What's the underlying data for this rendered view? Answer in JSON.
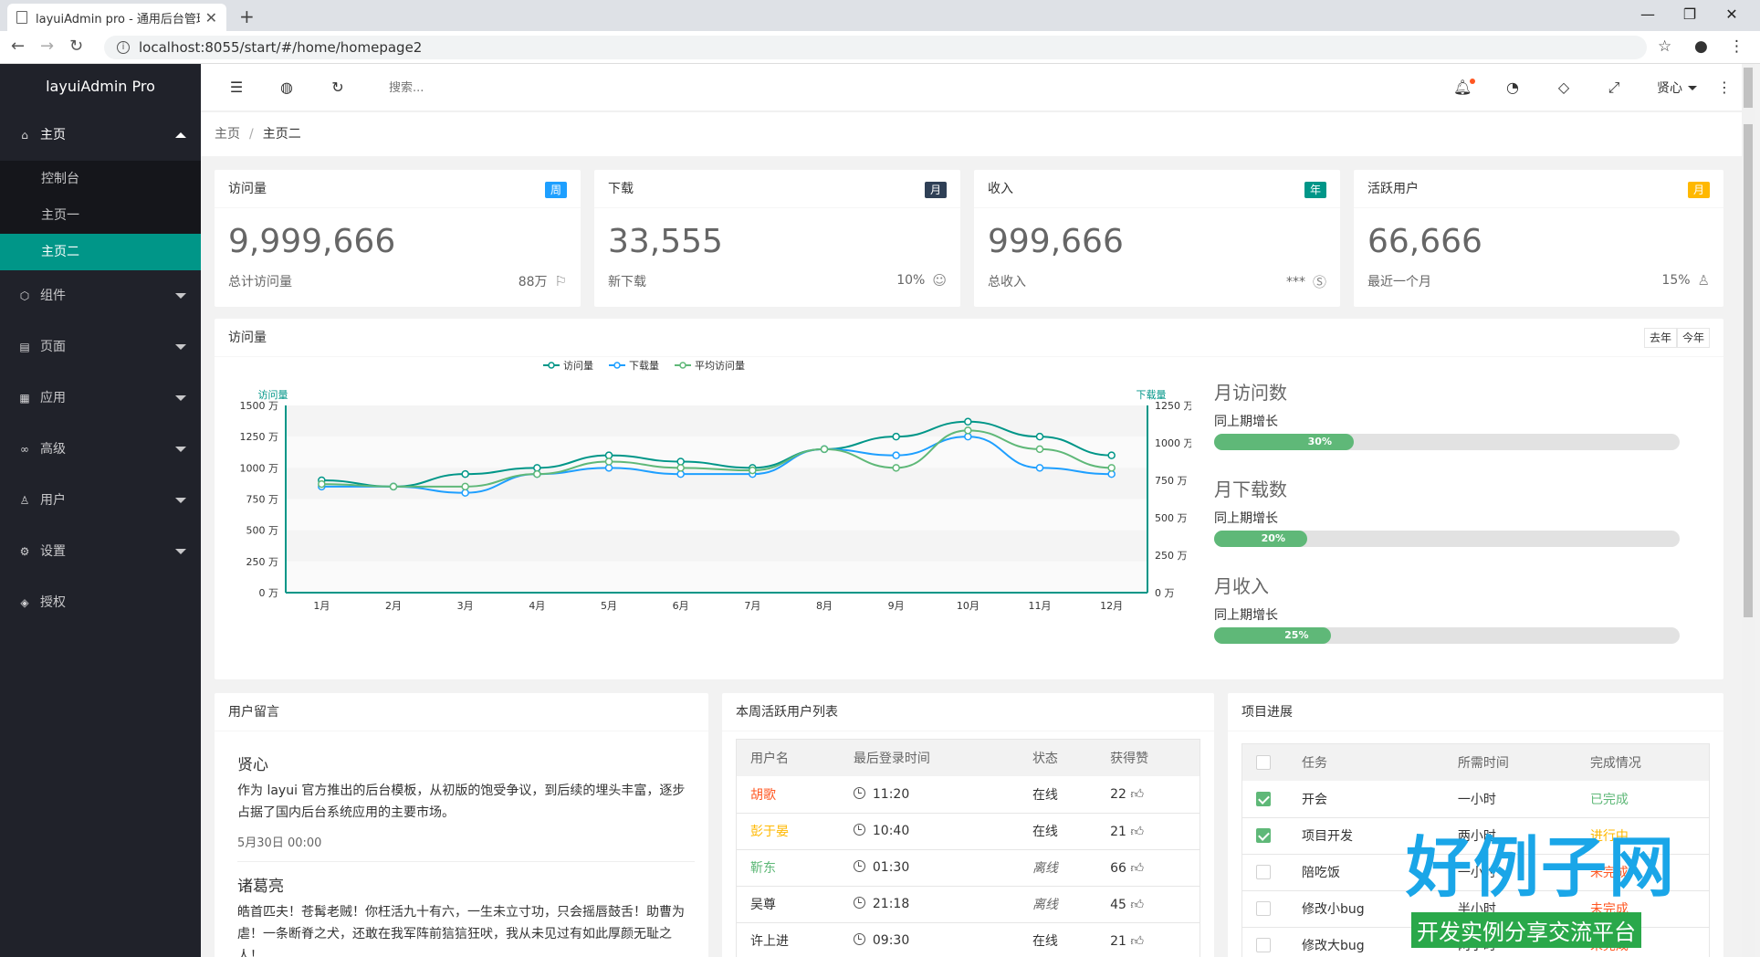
{
  "browser": {
    "tab_title": "layuiAdmin pro - 通用后台管理",
    "new_tab": "+",
    "url": "localhost:8055/start/#/home/homepage2"
  },
  "sidebar": {
    "logo": "layuiAdmin Pro",
    "items": [
      {
        "label": "主页",
        "icon": "home-icon"
      },
      {
        "label": "组件",
        "icon": "component-icon"
      },
      {
        "label": "页面",
        "icon": "page-icon"
      },
      {
        "label": "应用",
        "icon": "app-icon"
      },
      {
        "label": "高级",
        "icon": "senior-icon"
      },
      {
        "label": "用户",
        "icon": "user-icon"
      },
      {
        "label": "设置",
        "icon": "set-icon"
      },
      {
        "label": "授权",
        "icon": "auth-icon"
      }
    ],
    "sub": [
      "控制台",
      "主页一",
      "主页二"
    ]
  },
  "header": {
    "search_placeholder": "搜索...",
    "user": "贤心"
  },
  "breadcrumb": {
    "home": "主页",
    "sep": "/",
    "current": "主页二"
  },
  "stats": [
    {
      "title": "访问量",
      "badge": "周",
      "badge_color": "#1E9FFF",
      "value": "9,999,666",
      "sub": "总计访问量",
      "right": "88万",
      "icon": "flag-icon"
    },
    {
      "title": "下载",
      "badge": "月",
      "badge_color": "#2F4056",
      "value": "33,555",
      "sub": "新下载",
      "right": "10%",
      "icon": "smile-icon"
    },
    {
      "title": "收入",
      "badge": "年",
      "badge_color": "#009688",
      "value": "999,666",
      "sub": "总收入",
      "right": "***",
      "icon": "rmb-icon"
    },
    {
      "title": "活跃用户",
      "badge": "月",
      "badge_color": "#FFB800",
      "value": "66,666",
      "sub": "最近一个月",
      "right": "15%",
      "icon": "user-icon"
    }
  ],
  "visit_panel": {
    "title": "访问量",
    "btn_last": "去年",
    "btn_this": "今年",
    "progress": [
      {
        "title": "月访问数",
        "sub": "同上期增长",
        "value": 0.3,
        "label": "30%"
      },
      {
        "title": "月下载数",
        "sub": "同上期增长",
        "value": 0.2,
        "label": "20%"
      },
      {
        "title": "月收入",
        "sub": "同上期增长",
        "value": 0.25,
        "label": "25%"
      }
    ]
  },
  "chart_data": {
    "type": "line",
    "categories": [
      "1月",
      "2月",
      "3月",
      "4月",
      "5月",
      "6月",
      "7月",
      "8月",
      "9月",
      "10月",
      "11月",
      "12月"
    ],
    "series": [
      {
        "name": "访问量",
        "color": "#009688",
        "axis": "left",
        "values": [
          900,
          850,
          950,
          1000,
          1100,
          1050,
          1000,
          1150,
          1250,
          1370,
          1250,
          1100
        ]
      },
      {
        "name": "下载量",
        "color": "#1E9FFF",
        "axis": "right",
        "values": [
          850,
          850,
          800,
          950,
          1000,
          950,
          950,
          1150,
          1100,
          1250,
          1000,
          950
        ]
      },
      {
        "name": "平均访问量",
        "color": "#5FB878",
        "axis": "left",
        "values": [
          870,
          850,
          850,
          950,
          1050,
          1000,
          980,
          1150,
          1000,
          1300,
          1150,
          1000
        ]
      }
    ],
    "left_axis": {
      "label": "访问量",
      "ticks": [
        "0 万",
        "250 万",
        "500 万",
        "750 万",
        "1000 万",
        "1250 万",
        "1500 万"
      ],
      "ylim": [
        0,
        1500
      ]
    },
    "right_axis": {
      "label": "下载量",
      "ticks": [
        "0 万",
        "250 万",
        "500 万",
        "750 万",
        "1000 万",
        "1250 万"
      ],
      "ylim": [
        0,
        1250
      ]
    },
    "legend": "top-center"
  },
  "messages": {
    "title": "用户留言",
    "items": [
      {
        "name": "贤心",
        "text": "作为 layui 官方推出的后台模板，从初版的饱受争议，到后续的埋头丰富，逐步占据了国内后台系统应用的主要市场。",
        "time": "5月30日 00:00"
      },
      {
        "name": "诸葛亮",
        "text": "皓首匹夫！苍髯老贼！你枉活九十有六，一生未立寸功，只会摇唇鼓舌！助曹为虐！一条断脊之犬，还敢在我军阵前狺狺狂吠，我从未见过有如此厚颜无耻之人！",
        "time": ""
      }
    ]
  },
  "active_users": {
    "title": "本周活跃用户列表",
    "columns": [
      "用户名",
      "最后登录时间",
      "状态",
      "获得赞"
    ],
    "rows": [
      {
        "name": "胡歌",
        "color": "#FF5722",
        "time": "11:20",
        "status": "在线",
        "likes": "22"
      },
      {
        "name": "彭于晏",
        "color": "#FFB800",
        "time": "10:40",
        "status": "在线",
        "likes": "21"
      },
      {
        "name": "靳东",
        "color": "#5FB878",
        "time": "01:30",
        "status": "离线",
        "likes": "66"
      },
      {
        "name": "吴尊",
        "color": "#333333",
        "time": "21:18",
        "status": "离线",
        "likes": "45"
      },
      {
        "name": "许上进",
        "color": "#333333",
        "time": "09:30",
        "status": "在线",
        "likes": "21"
      }
    ]
  },
  "projects": {
    "title": "项目进展",
    "columns": [
      "任务",
      "所需时间",
      "完成情况"
    ],
    "rows": [
      {
        "task": "开会",
        "time": "一小时",
        "state": "已完成",
        "color": "#5FB878",
        "checked": true
      },
      {
        "task": "项目开发",
        "time": "两小时",
        "state": "进行中",
        "color": "#FFB800",
        "checked": true
      },
      {
        "task": "陪吃饭",
        "time": "一小时",
        "state": "未完成",
        "color": "#FF5722",
        "checked": false
      },
      {
        "task": "修改小bug",
        "time": "半小时",
        "state": "未完成",
        "color": "#FF5722",
        "checked": false
      },
      {
        "task": "修改大bug",
        "time": "两小时",
        "state": "未完成",
        "color": "#FF5722",
        "checked": false
      }
    ]
  },
  "watermark": {
    "big": "好例子网",
    "small": "开发实例分享交流平台"
  }
}
